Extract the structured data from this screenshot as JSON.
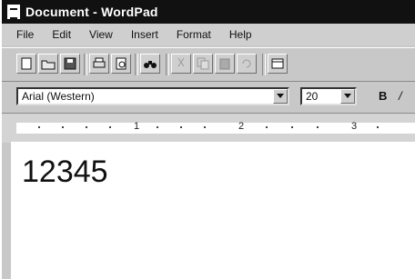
{
  "window": {
    "title": "Document - WordPad"
  },
  "menu": {
    "items": [
      "File",
      "Edit",
      "View",
      "Insert",
      "Format",
      "Help"
    ]
  },
  "toolbar": {
    "buttons": [
      {
        "name": "new",
        "icon": "new-document-icon"
      },
      {
        "name": "open",
        "icon": "open-folder-icon"
      },
      {
        "name": "save",
        "icon": "save-icon"
      },
      {
        "name": "print",
        "icon": "print-icon"
      },
      {
        "name": "print-preview",
        "icon": "print-preview-icon"
      },
      {
        "name": "find",
        "icon": "binoculars-icon"
      },
      {
        "name": "cut",
        "icon": "cut-icon"
      },
      {
        "name": "copy",
        "icon": "copy-icon"
      },
      {
        "name": "paste",
        "icon": "paste-icon"
      },
      {
        "name": "undo",
        "icon": "undo-icon"
      },
      {
        "name": "date-time",
        "icon": "date-time-icon"
      }
    ]
  },
  "format": {
    "font": "Arial (Western)",
    "size": "20",
    "bold_label": "B",
    "italic_label": "/"
  },
  "ruler": {
    "labels": [
      "1",
      "2",
      "3"
    ]
  },
  "document": {
    "text": "12345"
  },
  "colors": {
    "titlebar": "#111111",
    "chrome": "#c8c8c8",
    "page": "#ffffff"
  }
}
